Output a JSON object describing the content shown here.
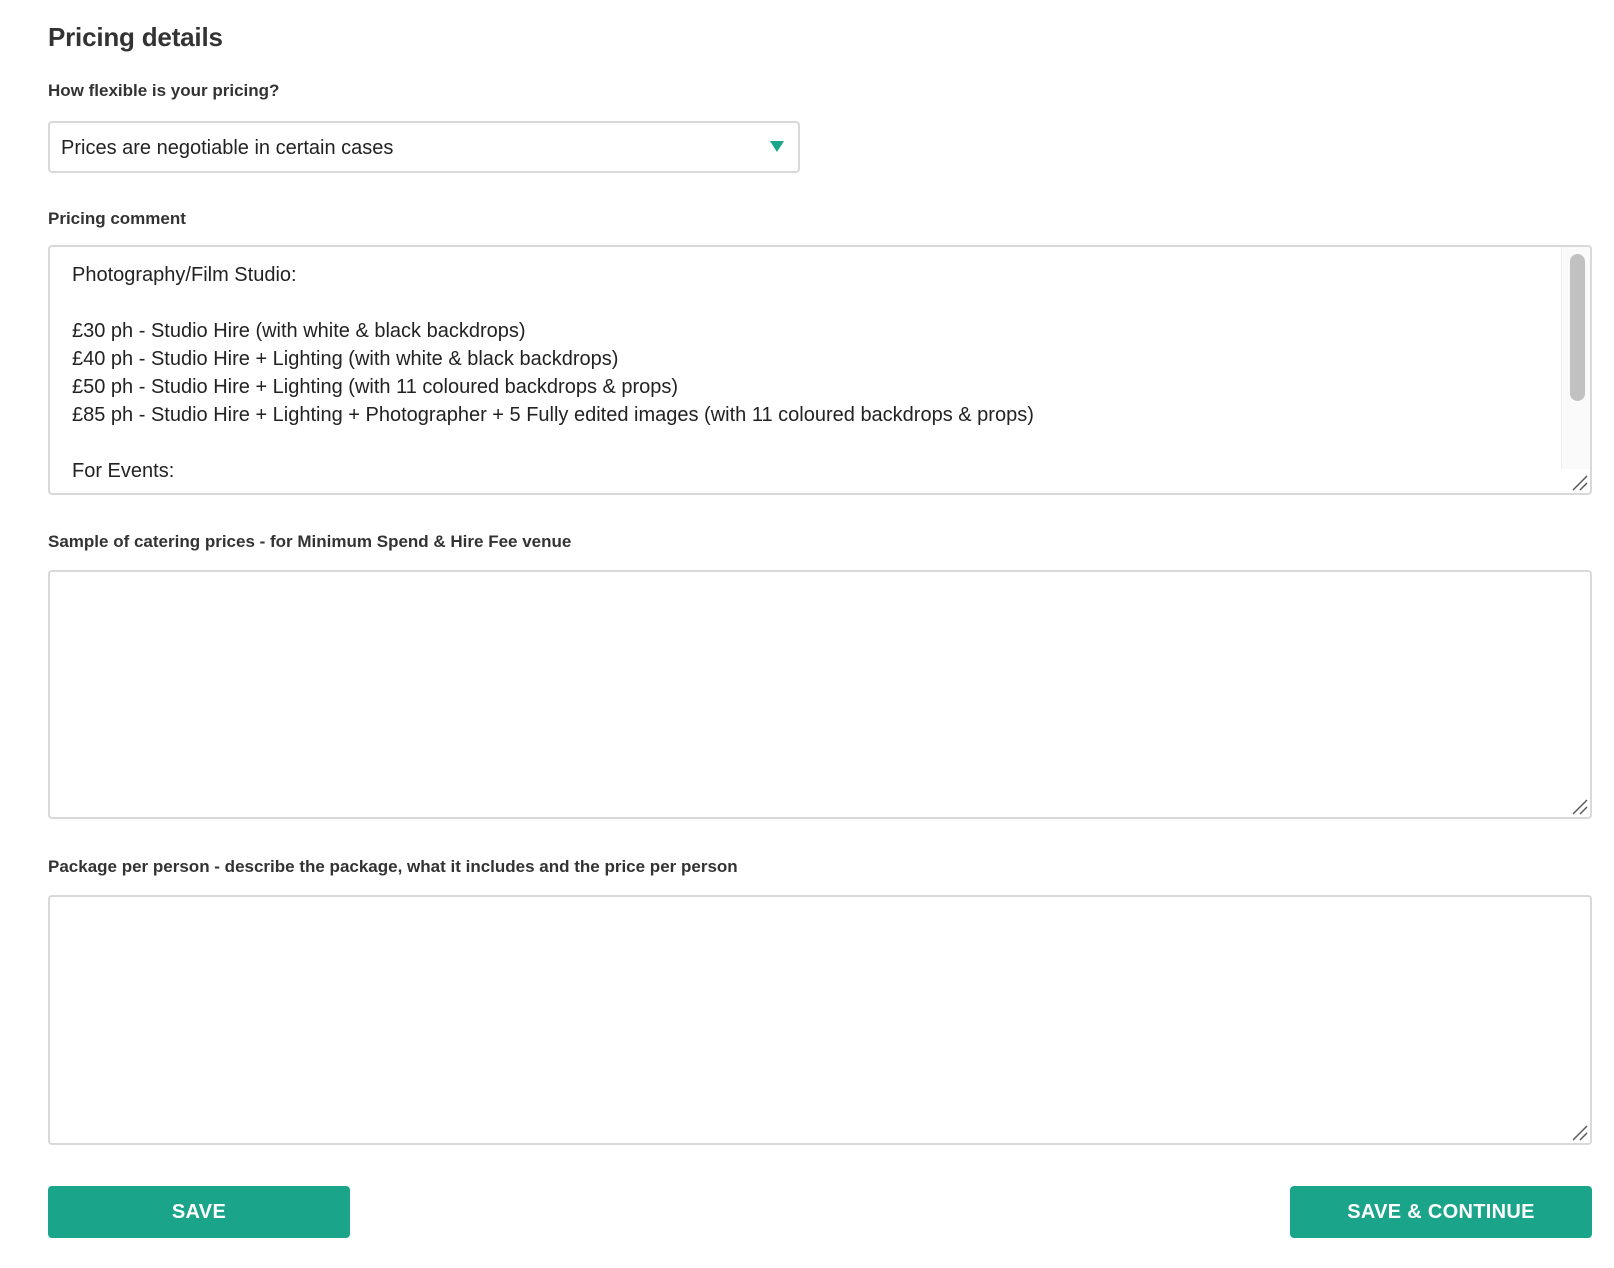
{
  "section": {
    "title": "Pricing details"
  },
  "flexibility": {
    "label": "How flexible is your pricing?",
    "selected": "Prices are negotiable in certain cases"
  },
  "pricing_comment": {
    "label": "Pricing comment",
    "value": "Photography/Film Studio:\n\n£30 ph - Studio Hire (with white & black backdrops)\n£40 ph - Studio Hire + Lighting (with white & black backdrops)\n£50 ph - Studio Hire + Lighting (with 11 coloured backdrops & props)\n£85 ph - Studio Hire + Lighting + Photographer + 5 Fully edited images (with 11 coloured backdrops & props)\n\nFor Events:"
  },
  "catering": {
    "label": "Sample of catering prices - for Minimum Spend & Hire Fee venue",
    "value": ""
  },
  "package": {
    "label": "Package per person - describe the package, what it includes and the price per person",
    "value": ""
  },
  "actions": {
    "save_label": "SAVE",
    "save_continue_label": "SAVE & CONTINUE"
  },
  "colors": {
    "accent": "#1aa58a",
    "border": "#d9d9d9",
    "text": "#333333"
  }
}
